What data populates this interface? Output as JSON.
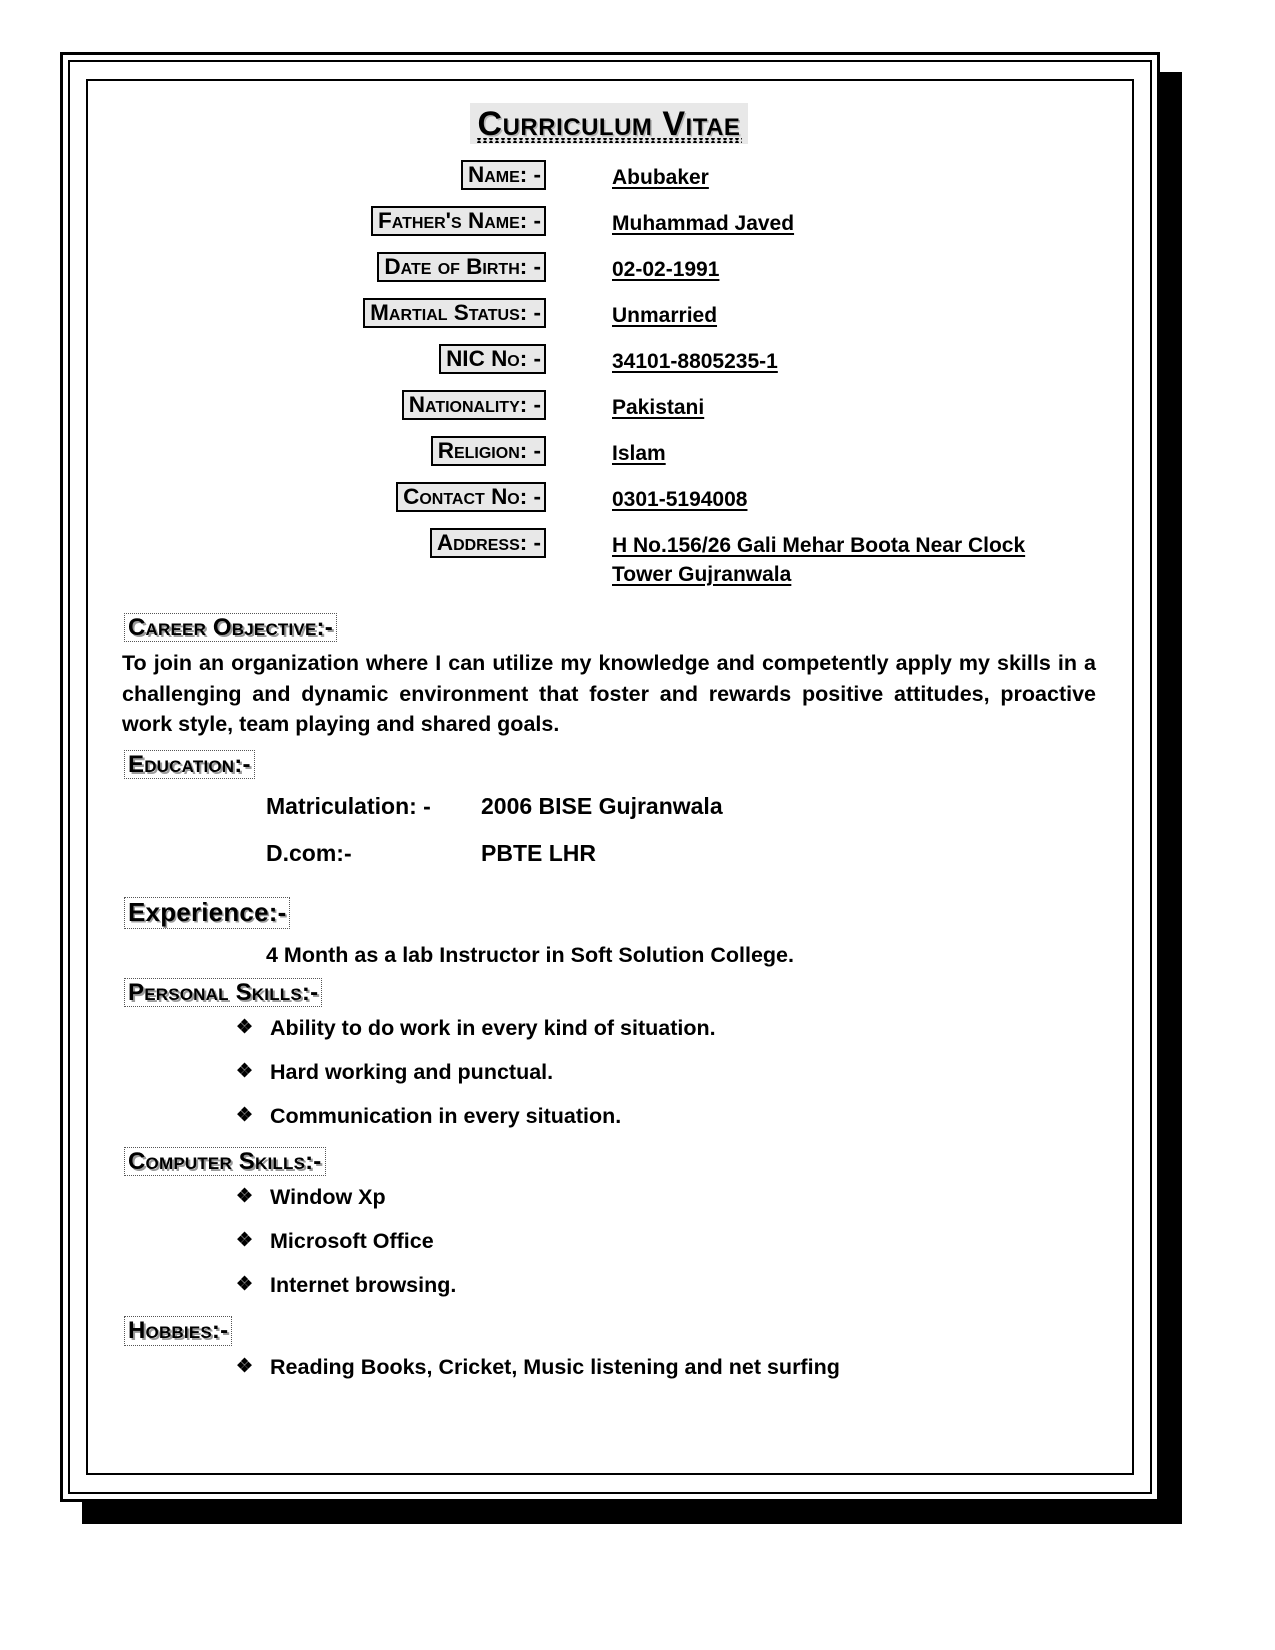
{
  "document": {
    "title": "Curriculum Vitae"
  },
  "personal_info": {
    "rows": [
      {
        "label": "Name: -",
        "value": "Abubaker"
      },
      {
        "label": "Father's Name: -",
        "value": "Muhammad Javed"
      },
      {
        "label": "Date of Birth: -",
        "value": "02-02-1991"
      },
      {
        "label": "Martial Status: -",
        "value": "Unmarried"
      },
      {
        "label": "NIC No: -",
        "value": "34101-8805235-1"
      },
      {
        "label": "Nationality: -",
        "value": "Pakistani"
      },
      {
        "label": "Religion: -",
        "value": "Islam"
      },
      {
        "label": "Contact No: -",
        "value": "0301-5194008"
      }
    ],
    "address": {
      "label": "Address: -",
      "line1": "H No.156/26 Gali Mehar Boota Near Clock",
      "line2": "Tower Gujranwala"
    }
  },
  "career_objective": {
    "heading": "Career Objective:-",
    "text": "To join an organization where I can utilize my knowledge and competently  apply my skills in a challenging and dynamic environment that foster and rewards positive attitudes, proactive work style, team playing and shared goals."
  },
  "education": {
    "heading": "Education:-",
    "entries": [
      {
        "degree": "Matriculation: -",
        "detail": "2006 BISE Gujranwala"
      },
      {
        "degree": "D.com:-",
        "detail": "PBTE LHR"
      }
    ]
  },
  "experience": {
    "heading": "Experience:-",
    "detail": "4 Month as a lab Instructor in Soft Solution College."
  },
  "personal_skills": {
    "heading": "Personal Skills:-",
    "items": [
      "Ability to do work in every kind of situation.",
      "Hard working and punctual.",
      "Communication in every situation."
    ]
  },
  "computer_skills": {
    "heading": "Computer Skills:-",
    "items": [
      "Window Xp",
      "Microsoft Office",
      "Internet browsing."
    ]
  },
  "hobbies": {
    "heading": "Hobbies:-",
    "items": [
      "Reading Books, Cricket, Music listening  and net surfing"
    ]
  },
  "icons": {
    "bullet": "❖"
  },
  "colors": {
    "label_fill": "#e8e8e8",
    "title_fill": "#e8e8e8",
    "text": "#000000",
    "shadow": "#9a9a9a"
  }
}
